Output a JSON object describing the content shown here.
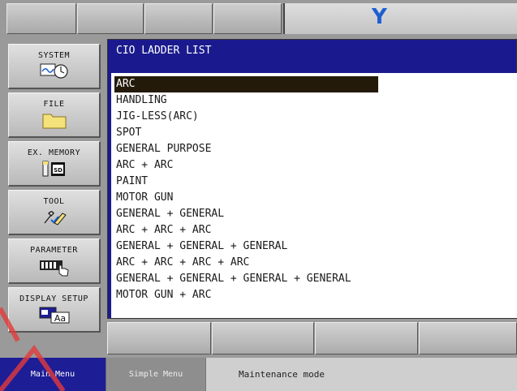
{
  "header": {
    "logo_text": "Y",
    "logo_color": "#1d5fd0"
  },
  "sidebar": {
    "items": [
      {
        "label": "SYSTEM",
        "icon": "system-clock-icon"
      },
      {
        "label": "FILE",
        "icon": "folder-icon"
      },
      {
        "label": "EX. MEMORY",
        "icon": "sd-card-icon"
      },
      {
        "label": "TOOL",
        "icon": "tool-icon"
      },
      {
        "label": "PARAMETER",
        "icon": "parameter-icon"
      },
      {
        "label": "DISPLAY SETUP",
        "icon": "display-setup-icon"
      }
    ]
  },
  "screen": {
    "title": "CIO LADDER LIST",
    "selected_index": 0,
    "items": [
      "ARC",
      "HANDLING",
      "JIG-LESS(ARC)",
      "SPOT",
      "GENERAL PURPOSE",
      "ARC + ARC",
      "PAINT",
      "MOTOR GUN",
      "GENERAL + GENERAL",
      "ARC + ARC + ARC",
      "GENERAL + GENERAL + GENERAL",
      "ARC + ARC + ARC + ARC",
      "GENERAL + GENERAL + GENERAL + GENERAL",
      "MOTOR GUN + ARC"
    ]
  },
  "statusbar": {
    "main_menu": "Main Menu",
    "simple_menu": "Simple Menu",
    "mode": "Maintenance mode"
  },
  "colors": {
    "screen_bg": "#1a1a8e",
    "selection_bg": "#241a0a",
    "main_menu_bg": "#1d1d96"
  }
}
